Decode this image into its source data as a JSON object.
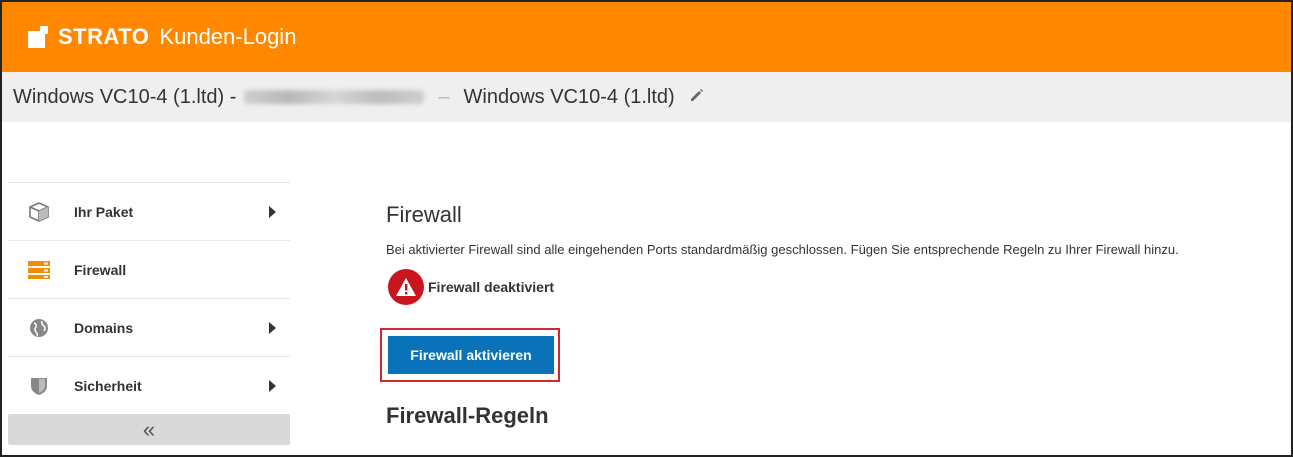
{
  "header": {
    "brand": "STRATO",
    "subtitle": "Kunden-Login",
    "brand_color": "#ff8800"
  },
  "titlebar": {
    "product": "Windows VC10-4 (1.ltd) -",
    "separator": "–",
    "product_name": "Windows VC10-4 (1.ltd)",
    "edit_icon": "pencil-icon"
  },
  "sidebar": {
    "items": [
      {
        "label": "Ihr Paket",
        "icon": "package-icon",
        "has_submenu": true
      },
      {
        "label": "Firewall",
        "icon": "firewall-icon",
        "has_submenu": false
      },
      {
        "label": "Domains",
        "icon": "globe-icon",
        "has_submenu": true
      },
      {
        "label": "Sicherheit",
        "icon": "shield-icon",
        "has_submenu": true
      }
    ],
    "collapse_label": "«"
  },
  "main": {
    "title": "Firewall",
    "description": "Bei aktivierter Firewall sind alle eingehenden Ports standardmäßig geschlossen. Fügen Sie entsprechende Regeln zu Ihrer Firewall hinzu.",
    "status_text": "Firewall deaktiviert",
    "status_color": "#c8151e",
    "activate_button": "Firewall aktivieren",
    "button_color": "#0a72b8",
    "rules_title": "Firewall-Regeln"
  }
}
